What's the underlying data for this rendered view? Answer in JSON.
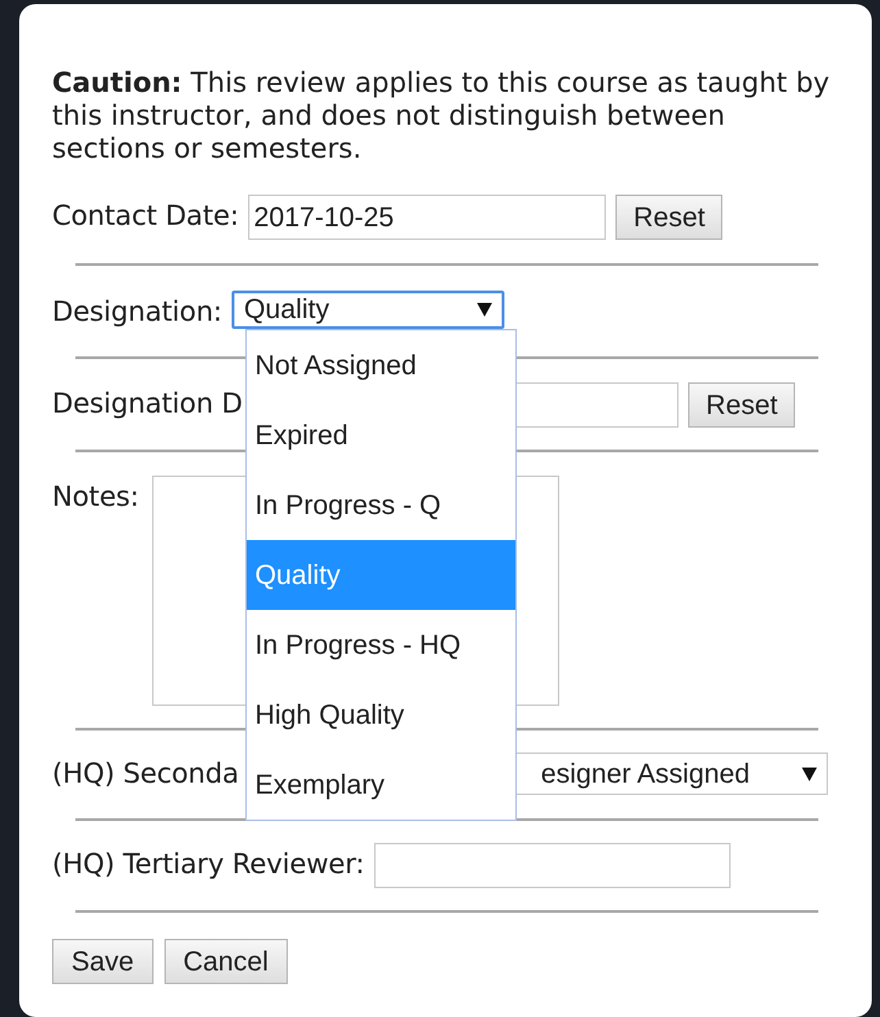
{
  "notice": {
    "text": "**Caution:** This review applies to this course as taught by this instructor, and does not distinguish between sections or semesters."
  },
  "fields": [
    {
      "kind": "input",
      "label": "Contact Date:",
      "value": "2017-10-25",
      "button": "Reset"
    },
    {
      "kind": "select",
      "label": "Designation:",
      "value": "Quality",
      "expanded": true,
      "options": [
        {
          "label": "Not Assigned",
          "selected": false
        },
        {
          "label": "Expired",
          "selected": false
        },
        {
          "label": "In Progress - Q",
          "selected": false
        },
        {
          "label": "Quality",
          "selected": true
        },
        {
          "label": "In Progress - HQ",
          "selected": false
        },
        {
          "label": "High Quality",
          "selected": false
        },
        {
          "label": "Exemplary",
          "selected": false
        }
      ]
    },
    {
      "kind": "input",
      "label": "Designation D",
      "button": "Reset"
    },
    {
      "kind": "textarea",
      "label": "Notes:"
    },
    {
      "kind": "select",
      "label": "(HQ) Seconda",
      "value": "esigner Assigned",
      "expanded": false
    },
    {
      "kind": "input",
      "label": "(HQ) Tertiary Reviewer:"
    }
  ],
  "buttons": [
    "Save",
    "Cancel"
  ]
}
